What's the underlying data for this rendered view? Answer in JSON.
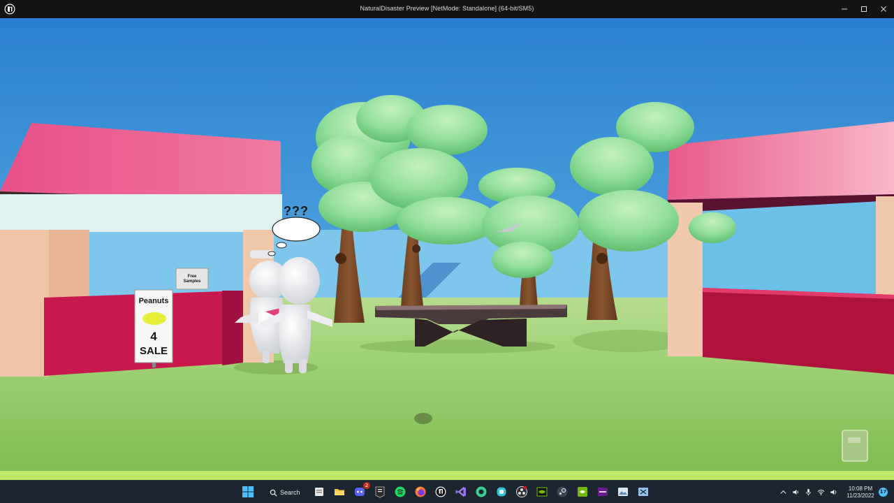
{
  "window": {
    "title": "NaturalDisaster Preview [NetMode: Standalone]  (64-bit/SM5)",
    "icon": "unreal-engine-logo-icon"
  },
  "scene": {
    "thought_bubble_text": "???",
    "stand_sign": {
      "line1": "Free",
      "line2": "Samples"
    },
    "sale_sign": {
      "line1": "Peanuts",
      "line2": "4",
      "line3": "SALE"
    }
  },
  "taskbar": {
    "search_label": "Search",
    "apps": [
      {
        "name": "start-icon"
      },
      {
        "name": "file-explorer-icon"
      },
      {
        "name": "folder-icon"
      },
      {
        "name": "discord-icon",
        "badge": "2"
      },
      {
        "name": "epic-games-icon"
      },
      {
        "name": "spotify-icon"
      },
      {
        "name": "firefox-icon"
      },
      {
        "name": "unreal-engine-icon"
      },
      {
        "name": "visual-studio-icon"
      },
      {
        "name": "app-green-icon"
      },
      {
        "name": "app-teal-icon"
      },
      {
        "name": "obs-icon"
      },
      {
        "name": "nvidia-icon"
      },
      {
        "name": "steam-icon"
      },
      {
        "name": "geforce-icon"
      },
      {
        "name": "next-app-icon"
      },
      {
        "name": "photos-icon"
      },
      {
        "name": "snipping-tool-icon"
      }
    ],
    "tray": {
      "time": "10:08 PM",
      "date": "11/23/2022",
      "notifications": "17"
    }
  },
  "colors": {
    "sky_top": "#2a7fd0",
    "sky_bottom": "#6ec0e8",
    "grass": "#8fc760",
    "roof": "#e85a8a",
    "counter": "#c0184c",
    "tree_leaves": "#8fdd9a",
    "trunk": "#7a4a28",
    "titlebar": "#141414",
    "taskbar": "#1c2630"
  }
}
